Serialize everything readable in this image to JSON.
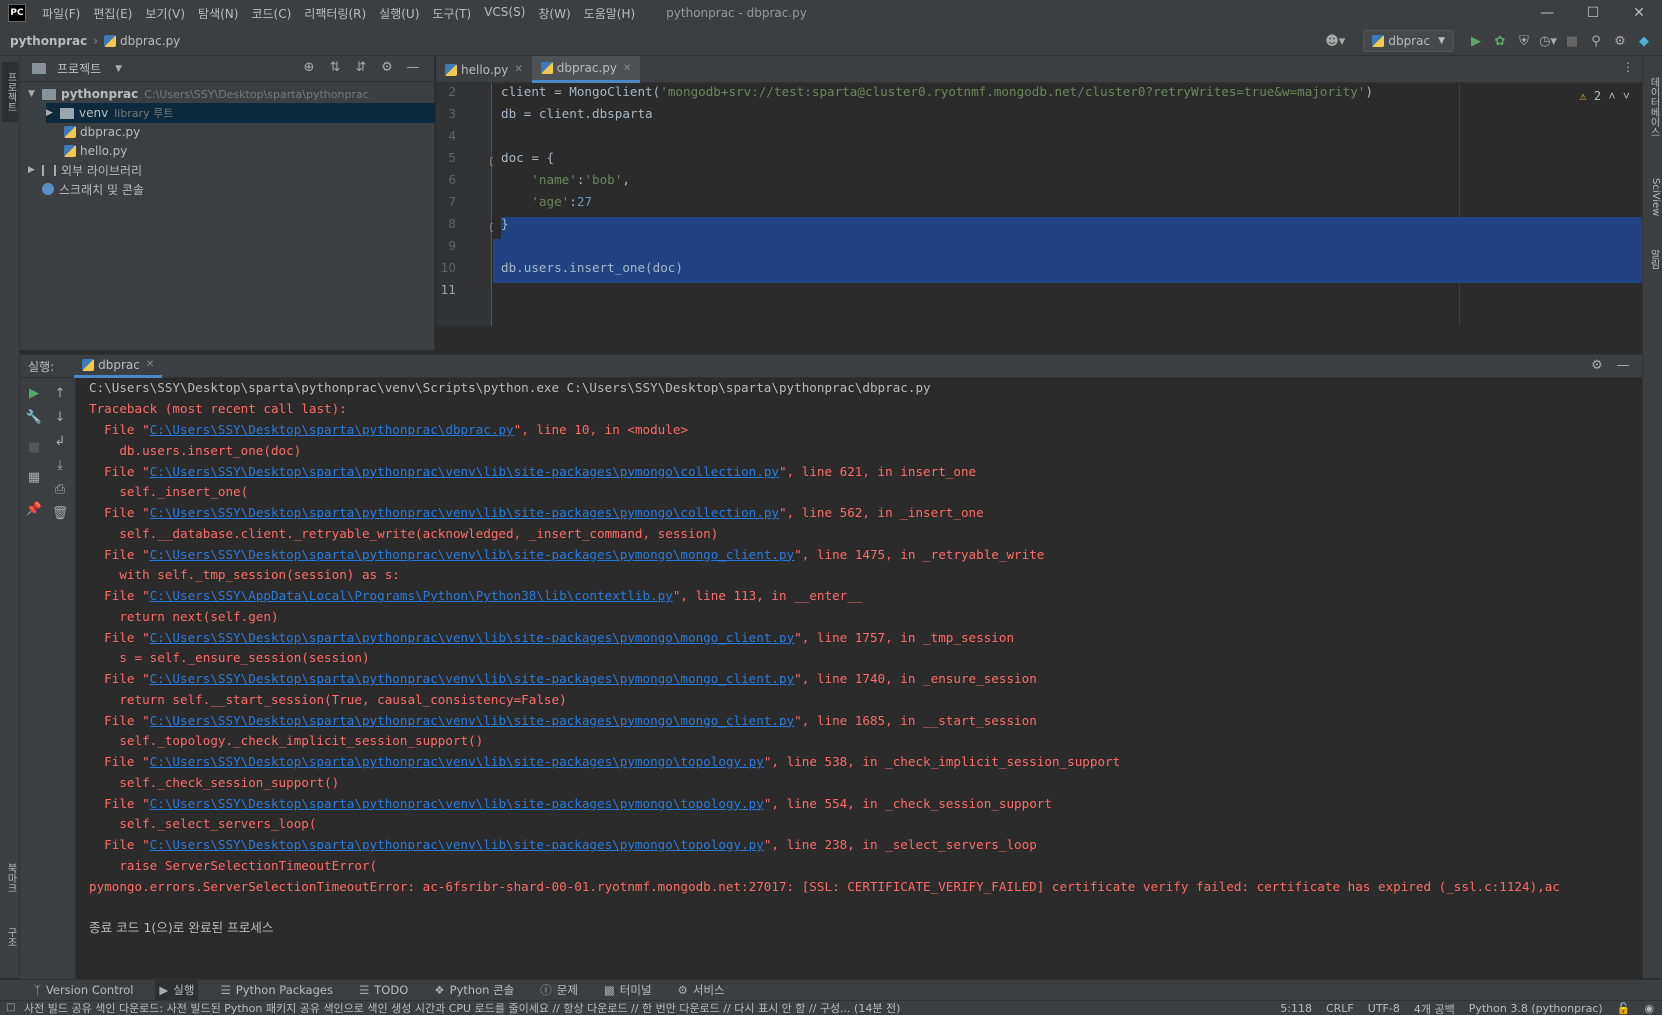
{
  "app": {
    "logo": "PC",
    "menu": [
      "파일(F)",
      "편집(E)",
      "보기(V)",
      "탐색(N)",
      "코드(C)",
      "리팩터링(R)",
      "실행(U)",
      "도구(T)",
      "VCS(S)",
      "창(W)",
      "도움말(H)"
    ],
    "window_title": "pythonprac - dbprac.py"
  },
  "navbar": {
    "project": "pythonprac",
    "file": "dbprac.py",
    "run_config": "dbprac"
  },
  "left_strip": {
    "project_tab": "프로젝트",
    "bookmarks_tab": "북마크",
    "structure_tab": "구조"
  },
  "right_strip": {
    "database_tab": "데이터베이스",
    "sciview_tab": "SciView",
    "notifications_tab": "알림"
  },
  "project_panel": {
    "title": "프로젝트",
    "root_name": "pythonprac",
    "root_path": "C:\\Users\\SSY\\Desktop\\sparta\\pythonprac",
    "venv": "venv",
    "venv_hint": "library 루트",
    "file1": "dbprac.py",
    "file2": "hello.py",
    "external_libs": "외부 라이브러리",
    "scratches": "스크래치 및 콘솔"
  },
  "editor": {
    "tabs": [
      {
        "label": "hello.py"
      },
      {
        "label": "dbprac.py"
      }
    ],
    "warning_count": "2",
    "line_numbers": [
      "2",
      "3",
      "4",
      "5",
      "6",
      "7",
      "8",
      "9",
      "10",
      "11"
    ],
    "lines": {
      "l2a": "client = MongoClient(",
      "l2b": "'mongodb+srv://test:sparta@cluster0.ryotnmf.mongodb.net/cluster0?retryWrites=true&w=majority'",
      "l2c": ")",
      "l3": "db = client.dbsparta",
      "l5": "doc = {",
      "l6a": "    ",
      "l6b": "'name'",
      "l6c": ":",
      "l6d": "'bob'",
      "l6e": ",",
      "l7a": "    ",
      "l7b": "'age'",
      "l7c": ":",
      "l7d": "27",
      "l8": "}",
      "l10": "db.users.insert_one(doc)"
    }
  },
  "run_panel": {
    "label": "실행:",
    "tab": "dbprac",
    "console": {
      "cmd": "C:\\Users\\SSY\\Desktop\\sparta\\pythonprac\\venv\\Scripts\\python.exe C:\\Users\\SSY\\Desktop\\sparta\\pythonprac\\dbprac.py",
      "traceback": "Traceback (most recent call last):",
      "frames": [
        {
          "path": "C:\\Users\\SSY\\Desktop\\sparta\\pythonprac\\dbprac.py",
          "tail": "\", line 10, in <module>",
          "code": "    db.users.insert_one(doc)"
        },
        {
          "path": "C:\\Users\\SSY\\Desktop\\sparta\\pythonprac\\venv\\lib\\site-packages\\pymongo\\collection.py",
          "tail": "\", line 621, in insert_one",
          "code": "    self._insert_one("
        },
        {
          "path": "C:\\Users\\SSY\\Desktop\\sparta\\pythonprac\\venv\\lib\\site-packages\\pymongo\\collection.py",
          "tail": "\", line 562, in _insert_one",
          "code": "    self.__database.client._retryable_write(acknowledged, _insert_command, session)"
        },
        {
          "path": "C:\\Users\\SSY\\Desktop\\sparta\\pythonprac\\venv\\lib\\site-packages\\pymongo\\mongo_client.py",
          "tail": "\", line 1475, in _retryable_write",
          "code": "    with self._tmp_session(session) as s:"
        },
        {
          "path": "C:\\Users\\SSY\\AppData\\Local\\Programs\\Python\\Python38\\lib\\contextlib.py",
          "tail": "\", line 113, in __enter__",
          "code": "    return next(self.gen)"
        },
        {
          "path": "C:\\Users\\SSY\\Desktop\\sparta\\pythonprac\\venv\\lib\\site-packages\\pymongo\\mongo_client.py",
          "tail": "\", line 1757, in _tmp_session",
          "code": "    s = self._ensure_session(session)"
        },
        {
          "path": "C:\\Users\\SSY\\Desktop\\sparta\\pythonprac\\venv\\lib\\site-packages\\pymongo\\mongo_client.py",
          "tail": "\", line 1740, in _ensure_session",
          "code": "    return self.__start_session(True, causal_consistency=False)"
        },
        {
          "path": "C:\\Users\\SSY\\Desktop\\sparta\\pythonprac\\venv\\lib\\site-packages\\pymongo\\mongo_client.py",
          "tail": "\", line 1685, in __start_session",
          "code": "    self._topology._check_implicit_session_support()"
        },
        {
          "path": "C:\\Users\\SSY\\Desktop\\sparta\\pythonprac\\venv\\lib\\site-packages\\pymongo\\topology.py",
          "tail": "\", line 538, in _check_implicit_session_support",
          "code": "    self._check_session_support()"
        },
        {
          "path": "C:\\Users\\SSY\\Desktop\\sparta\\pythonprac\\venv\\lib\\site-packages\\pymongo\\topology.py",
          "tail": "\", line 554, in _check_session_support",
          "code": "    self._select_servers_loop("
        },
        {
          "path": "C:\\Users\\SSY\\Desktop\\sparta\\pythonprac\\venv\\lib\\site-packages\\pymongo\\topology.py",
          "tail": "\", line 238, in _select_servers_loop",
          "code": "    raise ServerSelectionTimeoutError("
        }
      ],
      "file_prefix": "  File \"",
      "error": "pymongo.errors.ServerSelectionTimeoutError: ac-6fsribr-shard-00-01.ryotnmf.mongodb.net:27017: [SSL: CERTIFICATE_VERIFY_FAILED] certificate verify failed: certificate has expired (_ssl.c:1124),ac",
      "exit": "종료 코드 1(으)로 완료된 프로세스"
    }
  },
  "bottom_tabs": [
    "Version Control",
    "실행",
    "Python Packages",
    "TODO",
    "Python 콘솔",
    "문제",
    "터미널",
    "서비스"
  ],
  "status": {
    "message": "사전 빌드 공유 색인 다운로드: 사전 빌드된 Python 패키지 공유 색인으로 색인 생성 시간과 CPU 로드를 줄이세요 // 항상 다운로드 // 한 번만 다운로드 // 다시 표시 안 함 // 구성... (14분 전)",
    "position": "5:118",
    "line_sep": "CRLF",
    "encoding": "UTF-8",
    "indent": "4개 공백",
    "interpreter": "Python 3.8 (pythonprac)"
  }
}
